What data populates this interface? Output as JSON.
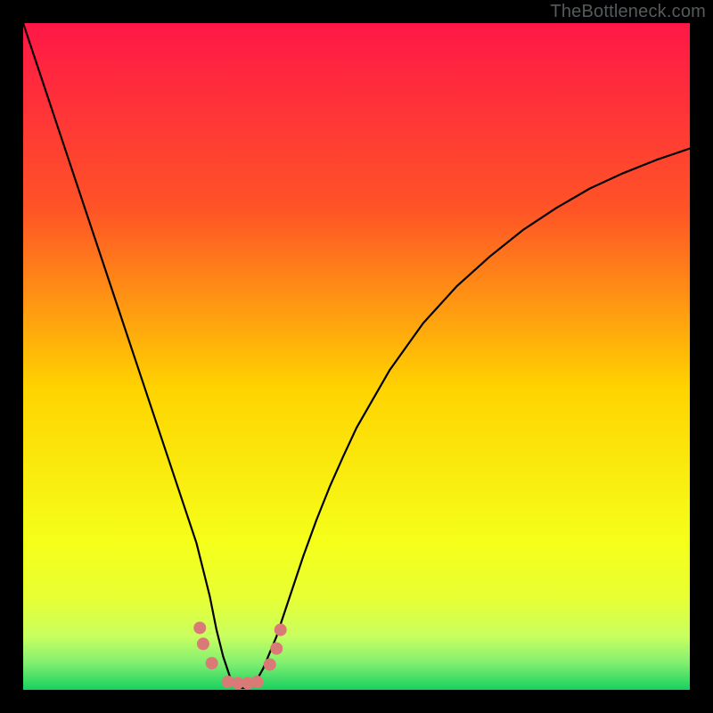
{
  "watermark": "TheBottleneck.com",
  "chart_data": {
    "type": "line",
    "title": "",
    "xlabel": "",
    "ylabel": "",
    "xlim": [
      0,
      100
    ],
    "ylim": [
      0,
      100
    ],
    "x": [
      0,
      2,
      4,
      6,
      8,
      10,
      12,
      14,
      16,
      18,
      20,
      22,
      24,
      26,
      28,
      29,
      30,
      31,
      32,
      33,
      34,
      35,
      36,
      38,
      40,
      42,
      44,
      46,
      48,
      50,
      55,
      60,
      65,
      70,
      75,
      80,
      85,
      90,
      95,
      100
    ],
    "values": [
      100,
      94,
      88,
      82,
      76,
      70,
      64,
      58,
      52,
      46,
      40,
      34,
      28,
      22,
      14,
      9,
      5,
      2,
      0.3,
      0.3,
      0.3,
      1.4,
      3.2,
      8,
      14,
      20,
      25.5,
      30.5,
      35,
      39.3,
      48,
      55,
      60.5,
      65,
      69,
      72.3,
      75.2,
      77.5,
      79.5,
      81.2
    ],
    "green_band": {
      "y_top": 5.0,
      "y_bottom": 0.0
    },
    "yellow_band": {
      "y_top": 12.0,
      "y_bottom": 5.0
    },
    "gradient_stops": [
      {
        "offset": 0.0,
        "color": "#ff1747"
      },
      {
        "offset": 0.28,
        "color": "#ff5426"
      },
      {
        "offset": 0.55,
        "color": "#ffd400"
      },
      {
        "offset": 0.78,
        "color": "#f5ff1a"
      },
      {
        "offset": 0.86,
        "color": "#e8ff33"
      },
      {
        "offset": 0.92,
        "color": "#c8ff60"
      },
      {
        "offset": 0.96,
        "color": "#80ef70"
      },
      {
        "offset": 1.0,
        "color": "#18d060"
      }
    ],
    "markers": {
      "color": "#d97a76",
      "radius_px": 7,
      "points": [
        {
          "x": 26.5,
          "y": 9.3
        },
        {
          "x": 27.0,
          "y": 6.9
        },
        {
          "x": 28.3,
          "y": 4.0
        },
        {
          "x": 30.7,
          "y": 1.2
        },
        {
          "x": 32.2,
          "y": 1.0
        },
        {
          "x": 33.7,
          "y": 1.0
        },
        {
          "x": 35.1,
          "y": 1.2
        },
        {
          "x": 37.0,
          "y": 3.8
        },
        {
          "x": 38.0,
          "y": 6.2
        },
        {
          "x": 38.6,
          "y": 9.0
        }
      ]
    }
  }
}
